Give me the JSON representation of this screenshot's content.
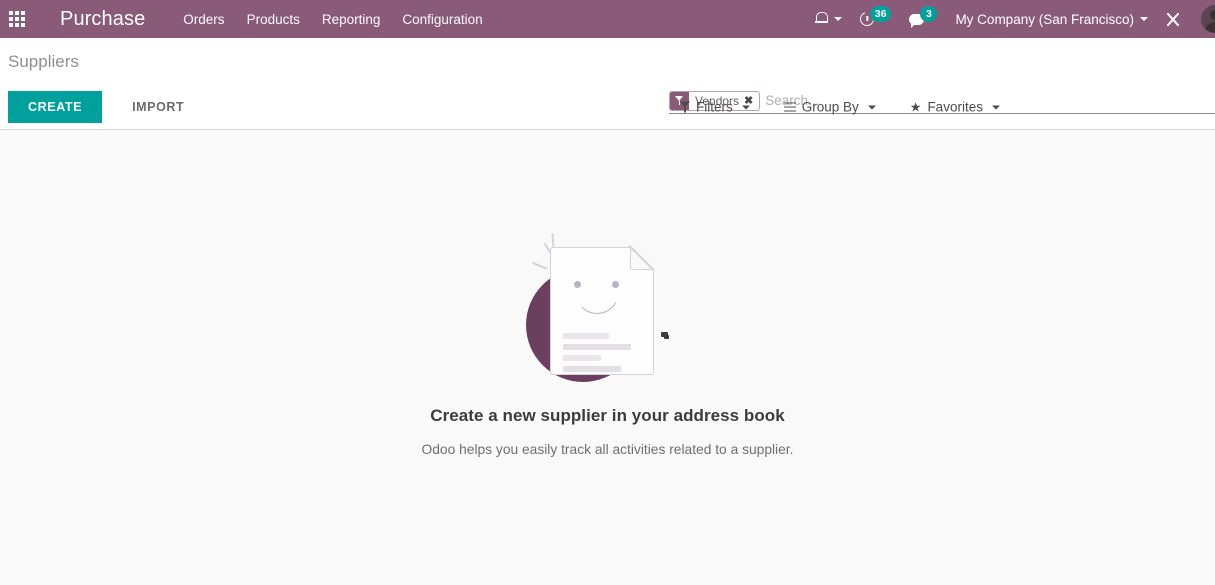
{
  "navbar": {
    "apps_icon": "apps-grid-icon",
    "brand": "Purchase",
    "menu_items": [
      {
        "label": "Orders"
      },
      {
        "label": "Products"
      },
      {
        "label": "Reporting"
      },
      {
        "label": "Configuration"
      }
    ],
    "systray": {
      "bell_icon": "bell-icon",
      "activity_icon": "activity-clock-icon",
      "activity_count": "36",
      "messaging_icon": "chat-bubble-icon",
      "messaging_count": "3",
      "company": "My Company (San Francisco)",
      "tools_icon": "tools-wrench-icon",
      "avatar_icon": "user-avatar"
    },
    "colors": {
      "background": "#8a5a79",
      "badge": "#00a09d"
    }
  },
  "control_panel": {
    "breadcrumb": "Suppliers",
    "create_label": "CREATE",
    "import_label": "IMPORT",
    "create_color": "#00a09d",
    "search": {
      "facet_label": "Vendors",
      "facet_icon": "funnel-filter-icon",
      "facet_remove": "✖",
      "placeholder": "Search...",
      "value": ""
    },
    "dropdowns": [
      {
        "label": "Filters",
        "icon": "funnel-icon"
      },
      {
        "label": "Group By",
        "icon": "bars-icon"
      },
      {
        "label": "Favorites",
        "icon": "star-icon"
      }
    ]
  },
  "content": {
    "empty_state": {
      "illustration": "smiling-document-illustration",
      "title": "Create a new supplier in your address book",
      "subtitle": "Odoo helps you easily track all activities related to a supplier."
    }
  }
}
